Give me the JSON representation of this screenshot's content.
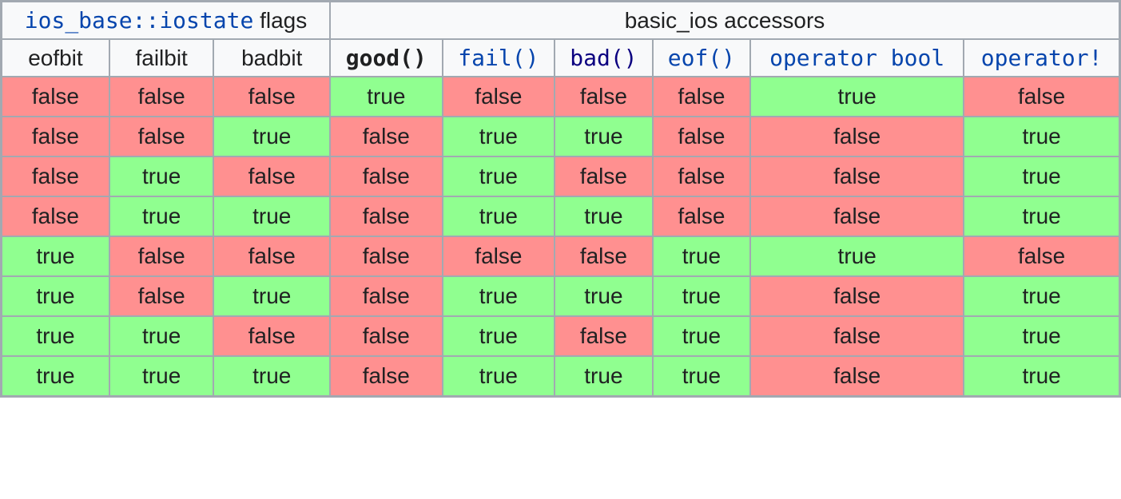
{
  "chart_data": {
    "type": "table",
    "title": "",
    "header_groups": [
      {
        "label_html": [
          {
            "text": "ios_base::iostate",
            "class": "mono link"
          },
          {
            "text": " flags",
            "class": "hdr-plain"
          }
        ],
        "colspan": 3,
        "name": "iostate-flags-header"
      },
      {
        "label_html": [
          {
            "text": "basic_ios",
            "class": "mono hdr-plain"
          },
          {
            "text": " accessors",
            "class": "hdr-plain"
          }
        ],
        "colspan": 6,
        "name": "basic-ios-accessors-header"
      }
    ],
    "columns": [
      {
        "label": "eofbit",
        "class": "mono hdr-plain",
        "name": "col-eofbit",
        "interactable": false
      },
      {
        "label": "failbit",
        "class": "mono hdr-plain",
        "name": "col-failbit",
        "interactable": false
      },
      {
        "label": "badbit",
        "class": "mono hdr-plain",
        "name": "col-badbit",
        "interactable": false
      },
      {
        "label": "good()",
        "class": "mono bold",
        "name": "col-good",
        "interactable": false
      },
      {
        "label": "fail()",
        "class": "mono link",
        "name": "col-fail",
        "interactable": true
      },
      {
        "label": "bad()",
        "class": "mono link-purple",
        "name": "col-bad",
        "interactable": true
      },
      {
        "label": "eof()",
        "class": "mono link",
        "name": "col-eof",
        "interactable": true
      },
      {
        "label": "operator bool",
        "class": "mono link",
        "name": "col-op-bool",
        "interactable": true
      },
      {
        "label": "operator!",
        "class": "mono link",
        "name": "col-op-not",
        "interactable": true
      }
    ],
    "rows": [
      [
        "false",
        "false",
        "false",
        "true",
        "false",
        "false",
        "false",
        "true",
        "false"
      ],
      [
        "false",
        "false",
        "true",
        "false",
        "true",
        "true",
        "false",
        "false",
        "true"
      ],
      [
        "false",
        "true",
        "false",
        "false",
        "true",
        "false",
        "false",
        "false",
        "true"
      ],
      [
        "false",
        "true",
        "true",
        "false",
        "true",
        "true",
        "false",
        "false",
        "true"
      ],
      [
        "true",
        "false",
        "false",
        "false",
        "false",
        "false",
        "true",
        "true",
        "false"
      ],
      [
        "true",
        "false",
        "true",
        "false",
        "true",
        "true",
        "true",
        "false",
        "true"
      ],
      [
        "true",
        "true",
        "false",
        "false",
        "true",
        "false",
        "true",
        "false",
        "true"
      ],
      [
        "true",
        "true",
        "true",
        "false",
        "true",
        "true",
        "true",
        "false",
        "true"
      ]
    ]
  },
  "true_label": "true",
  "false_label": "false",
  "colors": {
    "true_bg": "#90ff90",
    "false_bg": "#ff9090"
  }
}
